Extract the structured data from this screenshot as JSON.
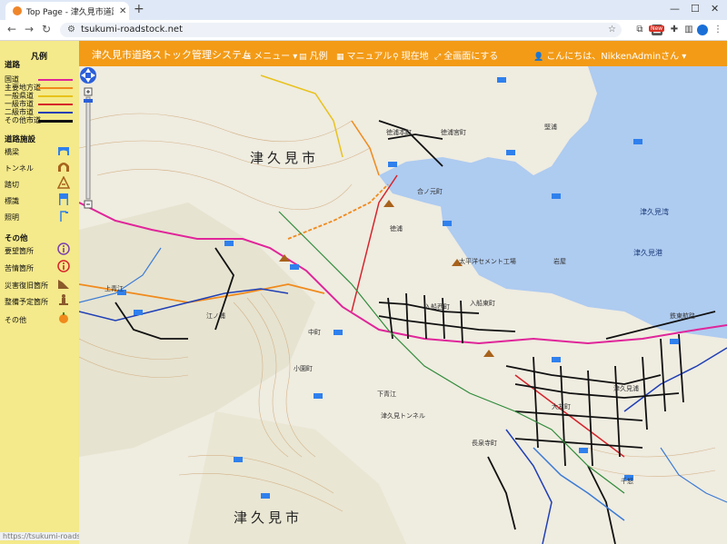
{
  "browser": {
    "tab_title": "Top Page - 津久見市道路ストック管理",
    "url": "tsukumi-roadstock.net",
    "new_badge": "New"
  },
  "header": {
    "brand": "津久見市道路ストック管理システム",
    "menu": "メニュー",
    "legend": "凡例",
    "manual": "マニュアル",
    "location": "現在地",
    "fullscreen": "全画面にする",
    "user": "こんにちは、NikkenAdminさん"
  },
  "legend": {
    "title": "凡例",
    "roads_header": "道路",
    "roads": [
      {
        "label": "国道",
        "color": "#e0259a"
      },
      {
        "label": "主要地方道",
        "color": "#f08a1c"
      },
      {
        "label": "一般県道",
        "color": "#e8c21a"
      },
      {
        "label": "一級市道",
        "color": "#d6232b"
      },
      {
        "label": "二級市道",
        "color": "#1f3fb6"
      },
      {
        "label": "その他市道",
        "color": "#111111"
      }
    ],
    "facilities_header": "道路施設",
    "facilities": [
      {
        "label": "橋梁",
        "icon": "bridge-icon"
      },
      {
        "label": "トンネル",
        "icon": "tunnel-icon"
      },
      {
        "label": "踏切",
        "icon": "railroad-crossing-icon"
      },
      {
        "label": "標識",
        "icon": "road-sign-icon"
      },
      {
        "label": "照明",
        "icon": "street-light-icon"
      }
    ],
    "other_header": "その他",
    "others": [
      {
        "label": "要望箇所",
        "icon": "request-info-icon"
      },
      {
        "label": "苦情箇所",
        "icon": "complaint-info-icon"
      },
      {
        "label": "災害復旧箇所",
        "icon": "disaster-recovery-icon"
      },
      {
        "label": "整備予定箇所",
        "icon": "maintenance-worker-icon"
      },
      {
        "label": "その他",
        "icon": "other-marker-icon"
      }
    ]
  },
  "map": {
    "city_label_top": "津久見市",
    "city_label_bottom": "津久見市",
    "bay_label": "津久見湾",
    "port_label": "津久見港",
    "place_labels": [
      "徳浦本町",
      "徳浦宮町",
      "合ノ元町",
      "徳浦",
      "太平洋セメント工場",
      "入船西町",
      "入船東町",
      "上青江",
      "中町",
      "下青江",
      "小園町",
      "津久見浦",
      "長泉寺町",
      "大友町",
      "千怒",
      "岩屋",
      "堅浦",
      "江ノ浦",
      "津久見トンネル",
      "鉄東航路"
    ]
  },
  "status": {
    "url_hint": "https://tsukumi-roadstock.net"
  },
  "colors": {
    "header_bg": "#f39b17",
    "legend_bg": "#f4e98b",
    "sea": "#aecbf0",
    "land": "#efece0"
  }
}
